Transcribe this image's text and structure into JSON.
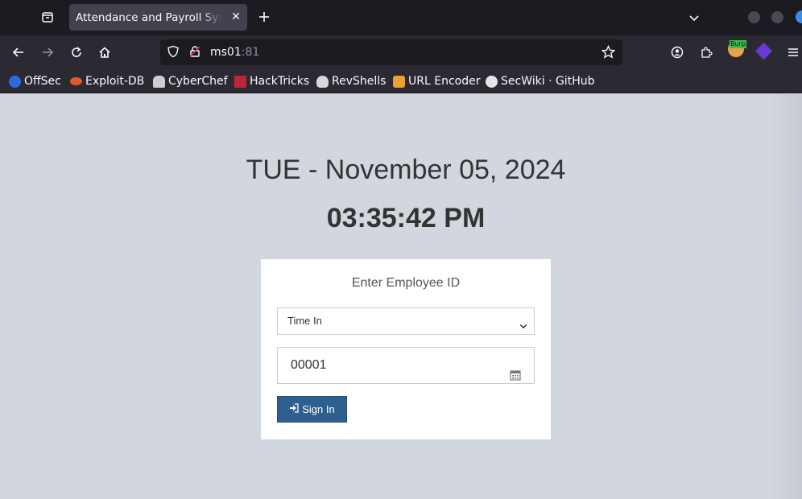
{
  "browser": {
    "tab_title": "Attendance and Payroll System",
    "tab_close": "✕",
    "url_host": "ms01",
    "url_port": ":81",
    "ext_badge": "Burp"
  },
  "bookmarks": [
    {
      "label": "OffSec",
      "color": "#2d6cdf"
    },
    {
      "label": "Exploit-DB",
      "color": "#e05a2b"
    },
    {
      "label": "CyberChef",
      "color": "#cfcfcf"
    },
    {
      "label": "HackTricks",
      "color": "#c0243a"
    },
    {
      "label": "RevShells",
      "color": "#d8d8d8"
    },
    {
      "label": "URL Encoder",
      "color": "#f0a030"
    },
    {
      "label": "SecWiki · GitHub",
      "color": "#e6e6e6"
    }
  ],
  "page": {
    "date": "TUE - November 05, 2024",
    "time": "03:35:42 PM",
    "box_title": "Enter Employee ID",
    "select_value": "Time In",
    "employee_id": "00001",
    "signin_label": "Sign In"
  }
}
